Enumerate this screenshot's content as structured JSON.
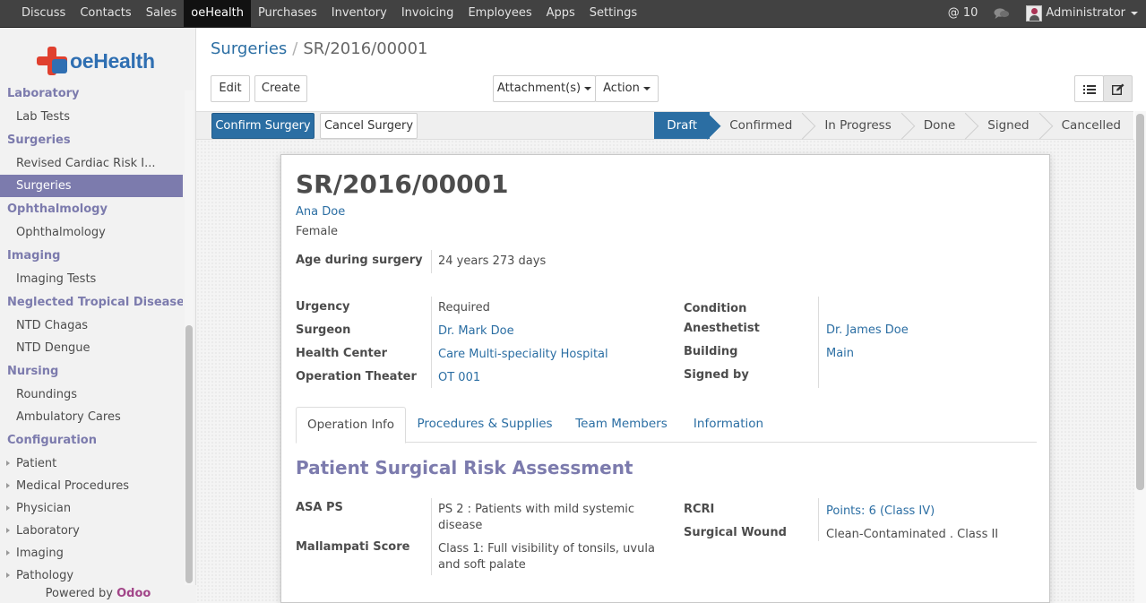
{
  "topnav": {
    "menu": [
      "Discuss",
      "Contacts",
      "Sales",
      "oeHealth",
      "Purchases",
      "Inventory",
      "Invoicing",
      "Employees",
      "Apps",
      "Settings"
    ],
    "active": "oeHealth",
    "mentions": "@ 10",
    "user": "Administrator"
  },
  "sidebar": {
    "logo_text": "oeHealth",
    "sections": [
      {
        "title": "Laboratory",
        "items": [
          {
            "label": "Lab Tests"
          }
        ]
      },
      {
        "title": "Surgeries",
        "items": [
          {
            "label": "Revised Cardiac Risk I..."
          },
          {
            "label": "Surgeries",
            "active": true
          }
        ]
      },
      {
        "title": "Ophthalmology",
        "items": [
          {
            "label": "Ophthalmology"
          }
        ]
      },
      {
        "title": "Imaging",
        "items": [
          {
            "label": "Imaging Tests"
          }
        ]
      },
      {
        "title": "Neglected Tropical Diseases",
        "items": [
          {
            "label": "NTD Chagas"
          },
          {
            "label": "NTD Dengue"
          }
        ]
      },
      {
        "title": "Nursing",
        "items": [
          {
            "label": "Roundings"
          },
          {
            "label": "Ambulatory Cares"
          }
        ]
      },
      {
        "title": "Configuration",
        "items": [
          {
            "label": "Patient",
            "tree": true
          },
          {
            "label": "Medical Procedures",
            "tree": true
          },
          {
            "label": "Physician",
            "tree": true
          },
          {
            "label": "Laboratory",
            "tree": true
          },
          {
            "label": "Imaging",
            "tree": true
          },
          {
            "label": "Pathology",
            "tree": true
          }
        ]
      }
    ],
    "powered_by": "Powered by",
    "powered_brand": "Odoo"
  },
  "breadcrumb": {
    "parent": "Surgeries",
    "current": "SR/2016/00001"
  },
  "toolbar": {
    "edit": "Edit",
    "create": "Create",
    "attachments": "Attachment(s)",
    "action": "Action",
    "list_view_icon": "list-icon",
    "form_view_icon": "edit-icon"
  },
  "statusbar": {
    "confirm": "Confirm Surgery",
    "cancel": "Cancel Surgery",
    "steps": [
      "Draft",
      "Confirmed",
      "In Progress",
      "Done",
      "Signed",
      "Cancelled"
    ],
    "active_step": "Draft"
  },
  "record": {
    "name": "SR/2016/00001",
    "patient": "Ana Doe",
    "sex": "Female",
    "age_label": "Age during surgery",
    "age_value": "24 years 273 days",
    "urgency_label": "Urgency",
    "urgency_value": "Required",
    "surgeon_label": "Surgeon",
    "surgeon_value": "Dr. Mark Doe",
    "health_center_label": "Health Center",
    "health_center_value": "Care Multi-speciality Hospital",
    "ot_label": "Operation Theater",
    "ot_value": "OT 001",
    "condition_label": "Condition",
    "condition_value": "",
    "anesthetist_label": "Anesthetist",
    "anesthetist_value": "Dr. James Doe",
    "building_label": "Building",
    "building_value": "Main",
    "signed_label": "Signed by",
    "signed_value": ""
  },
  "tabs": [
    "Operation Info",
    "Procedures & Supplies",
    "Team Members",
    "Information"
  ],
  "risk": {
    "title": "Patient Surgical Risk Assessment",
    "asa_label": "ASA PS",
    "asa_line1": "PS 2 : Patients with mild systemic",
    "asa_line2": "disease",
    "mallampati_label": "Mallampati Score",
    "mallampati_line1": "Class 1: Full visibility of tonsils, uvula",
    "mallampati_line2": "and soft palate",
    "rcri_label": "RCRI",
    "rcri_value": "Points: 6 (Class IV)",
    "wound_label": "Surgical Wound",
    "wound_value": "Clean-Contaminated . Class II"
  }
}
